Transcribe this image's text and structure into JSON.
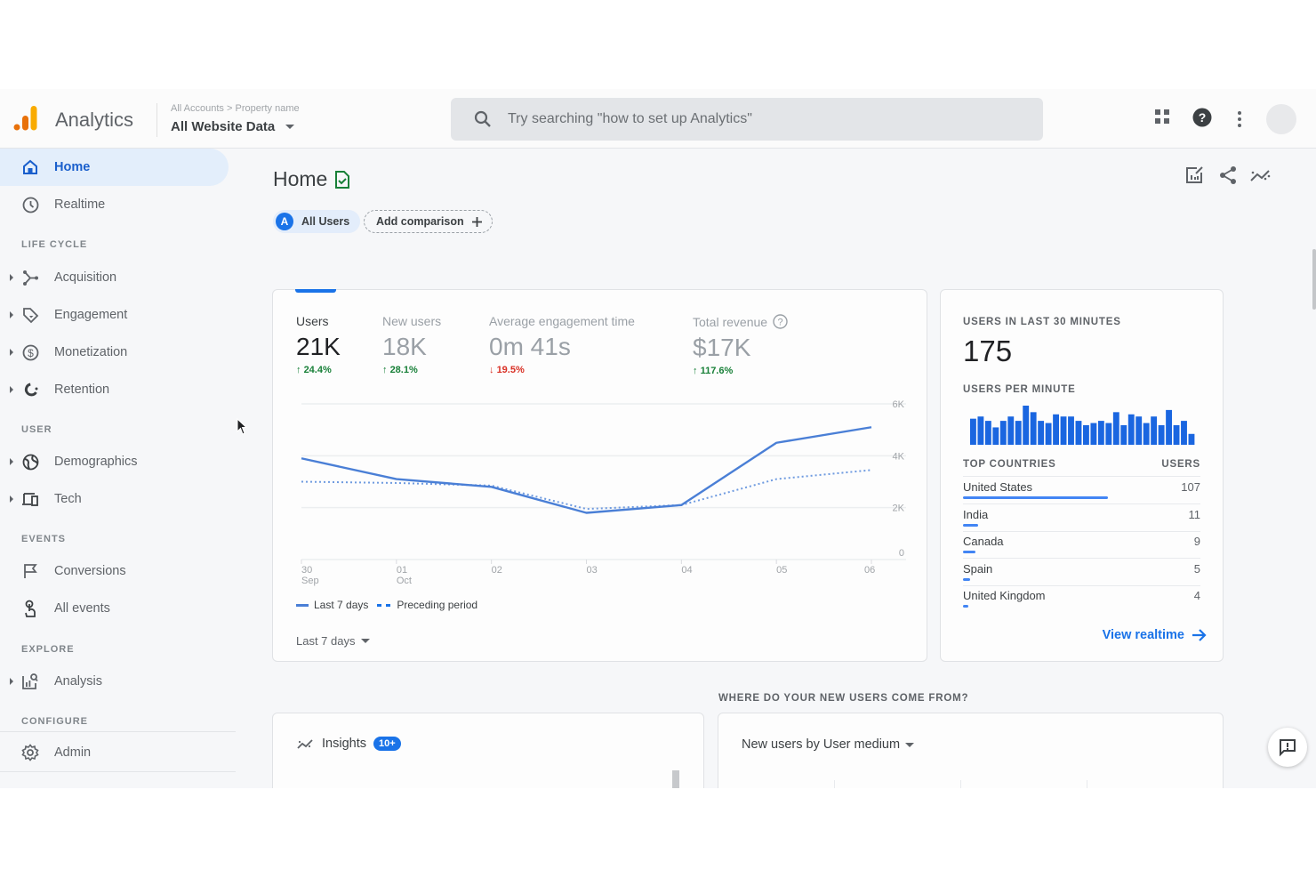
{
  "app": {
    "brand": "Analytics",
    "breadcrumb": {
      "accounts": "All Accounts",
      "separator": ">",
      "property": "Property name"
    },
    "property_selector": "All Website Data",
    "search_placeholder": "Try searching \"how to set up Analytics\"",
    "brand_colors": {
      "logo_dark": "#e8710a",
      "logo_light": "#f9ab00",
      "accent": "#1a73e8"
    }
  },
  "sidebar": {
    "items": [
      {
        "label": "Home",
        "icon": "home-icon",
        "active": true
      },
      {
        "label": "Realtime",
        "icon": "clock-icon"
      }
    ],
    "sections": [
      {
        "title": "LIFE CYCLE",
        "items": [
          {
            "label": "Acquisition",
            "icon": "acquisition-icon"
          },
          {
            "label": "Engagement",
            "icon": "tag-icon"
          },
          {
            "label": "Monetization",
            "icon": "dollar-icon"
          },
          {
            "label": "Retention",
            "icon": "magnet-icon"
          }
        ]
      },
      {
        "title": "USER",
        "items": [
          {
            "label": "Demographics",
            "icon": "globe-icon"
          },
          {
            "label": "Tech",
            "icon": "devices-icon"
          }
        ]
      },
      {
        "title": "EVENTS",
        "items": [
          {
            "label": "Conversions",
            "icon": "flag-icon"
          },
          {
            "label": "All events",
            "icon": "touch-icon"
          }
        ]
      },
      {
        "title": "EXPLORE",
        "items": [
          {
            "label": "Analysis",
            "icon": "analysis-icon"
          }
        ]
      },
      {
        "title": "CONFIGURE",
        "items": [
          {
            "label": "Admin",
            "icon": "gear-icon"
          }
        ]
      }
    ]
  },
  "page": {
    "title": "Home",
    "segment_chip": {
      "letter": "A",
      "label": "All Users"
    },
    "add_comparison": "Add comparison"
  },
  "overview": {
    "metrics": [
      {
        "label": "Users",
        "value": "21K",
        "delta": "24.4%",
        "direction": "up"
      },
      {
        "label": "New users",
        "value": "18K",
        "delta": "28.1%",
        "direction": "up"
      },
      {
        "label": "Average engagement time",
        "value": "0m 41s",
        "delta": "19.5%",
        "direction": "down"
      },
      {
        "label": "Total revenue",
        "value": "$17K",
        "delta": "117.6%",
        "direction": "up"
      }
    ],
    "legend": {
      "current": "Last 7 days",
      "previous": "Preceding period"
    },
    "range": "Last 7 days"
  },
  "realtime": {
    "title": "USERS IN LAST 30 MINUTES",
    "value": "175",
    "per_minute_title": "USERS PER MINUTE",
    "per_minute": [
      6,
      6.5,
      5.5,
      4,
      5.5,
      6.5,
      5.5,
      9,
      7.5,
      5.5,
      5,
      7,
      6.5,
      6.5,
      5.5,
      4.5,
      5,
      5.5,
      5,
      7.5,
      4.5,
      7,
      6.5,
      5,
      6.5,
      4.5,
      8,
      4.5,
      5.5,
      2.5
    ],
    "countries_header": "TOP COUNTRIES",
    "users_header": "USERS",
    "countries": [
      {
        "name": "United States",
        "users": 107
      },
      {
        "name": "India",
        "users": 11
      },
      {
        "name": "Canada",
        "users": 9
      },
      {
        "name": "Spain",
        "users": 5
      },
      {
        "name": "United Kingdom",
        "users": 4
      }
    ],
    "view_link": "View realtime"
  },
  "lower": {
    "where_title": "WHERE DO YOUR NEW USERS COME FROM?",
    "insights_label": "Insights",
    "insights_badge": "10+",
    "medium_selector": "New users by User medium"
  },
  "chart_data": {
    "type": "line",
    "title": "Users",
    "x": [
      "30 Sep",
      "01 Oct",
      "02",
      "03",
      "04",
      "05",
      "06"
    ],
    "x_ticks": [
      {
        "top": "30",
        "bottom": "Sep"
      },
      {
        "top": "01",
        "bottom": "Oct"
      },
      {
        "top": "02",
        "bottom": ""
      },
      {
        "top": "03",
        "bottom": ""
      },
      {
        "top": "04",
        "bottom": ""
      },
      {
        "top": "05",
        "bottom": ""
      },
      {
        "top": "06",
        "bottom": ""
      }
    ],
    "y_ticks": [
      "0",
      "2K",
      "4K",
      "6K"
    ],
    "ylim": [
      0,
      6000
    ],
    "y_axis_side": "right",
    "grid": true,
    "legend_position": "bottom-left",
    "series": [
      {
        "name": "Last 7 days",
        "style": "solid",
        "color": "#4a7fd6",
        "values": [
          3900,
          3100,
          2800,
          1800,
          2100,
          4500,
          5100
        ]
      },
      {
        "name": "Preceding period",
        "style": "dotted",
        "color": "#6f9be0",
        "values": [
          3000,
          2950,
          2850,
          1950,
          2100,
          3100,
          3450
        ]
      }
    ]
  }
}
